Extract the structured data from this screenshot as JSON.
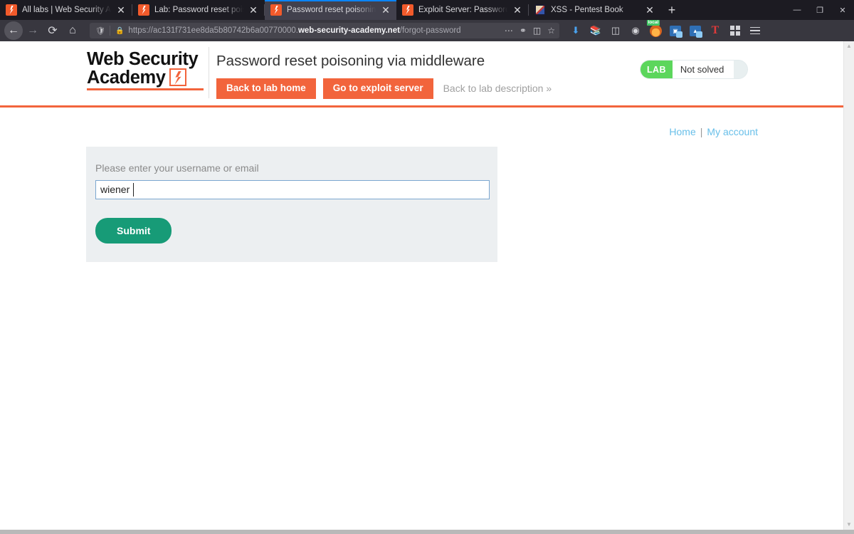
{
  "browser": {
    "tabs": [
      {
        "title": "All labs | Web Security Academy",
        "favicon": "burp-icon",
        "active": false
      },
      {
        "title": "Lab: Password reset poisoning via middleware",
        "favicon": "burp-icon",
        "active": false
      },
      {
        "title": "Password reset poisoning via middleware",
        "favicon": "burp-icon",
        "active": true
      },
      {
        "title": "Exploit Server: Password reset poisoning",
        "favicon": "burp-icon",
        "active": false
      },
      {
        "title": "XSS - Pentest Book",
        "favicon": "book-icon",
        "active": false
      }
    ],
    "new_tab_label": "+",
    "close_label": "✕",
    "window_controls": {
      "minimize": "—",
      "maximize": "❐",
      "close": "✕"
    },
    "nav": {
      "back": "←",
      "forward": "→",
      "reload": "⟳",
      "home": "⌂"
    },
    "url": {
      "scheme": "https://",
      "subdomain": "ac131f731ee8da5b80742b6a00770000.",
      "domain": "web-security-academy.net",
      "path": "/forgot-password",
      "shield_icon": "shield-icon",
      "lock_icon": "lock-icon",
      "more_icon": "ellipsis-icon",
      "pocket_icon": "pocket-icon",
      "reader_icon": "reader-icon",
      "bookmark_icon": "star-icon"
    },
    "toolbar_icons": [
      "download-icon",
      "library-icon",
      "sidebar-icon",
      "account-icon",
      "local-extension-icon",
      "translate-extension-icon",
      "wappalyzer-extension-icon",
      "text-extension-icon",
      "extensions-grid-icon",
      "menu-icon"
    ],
    "local_badge": "local"
  },
  "header": {
    "logo": {
      "line1": "Web Security",
      "line2": "Academy",
      "bolt_icon": "burp-bolt-icon"
    },
    "lab_title": "Password reset poisoning via middleware",
    "buttons": {
      "back_to_lab_home": "Back to lab home",
      "go_to_exploit_server": "Go to exploit server",
      "back_to_lab_description": "Back to lab description »"
    },
    "status": {
      "tag": "LAB",
      "state": "Not solved"
    }
  },
  "content": {
    "account_nav": {
      "home": "Home",
      "separator": "|",
      "my_account": "My account"
    },
    "form": {
      "label": "Please enter your username or email",
      "input_value": "wiener",
      "input_placeholder": "",
      "submit_label": "Submit"
    }
  },
  "colors": {
    "accent_orange": "#f2643c",
    "submit_green": "#179b77",
    "lab_green": "#5cd65c",
    "link_blue": "#68bfe9",
    "form_bg": "#eceff1"
  }
}
